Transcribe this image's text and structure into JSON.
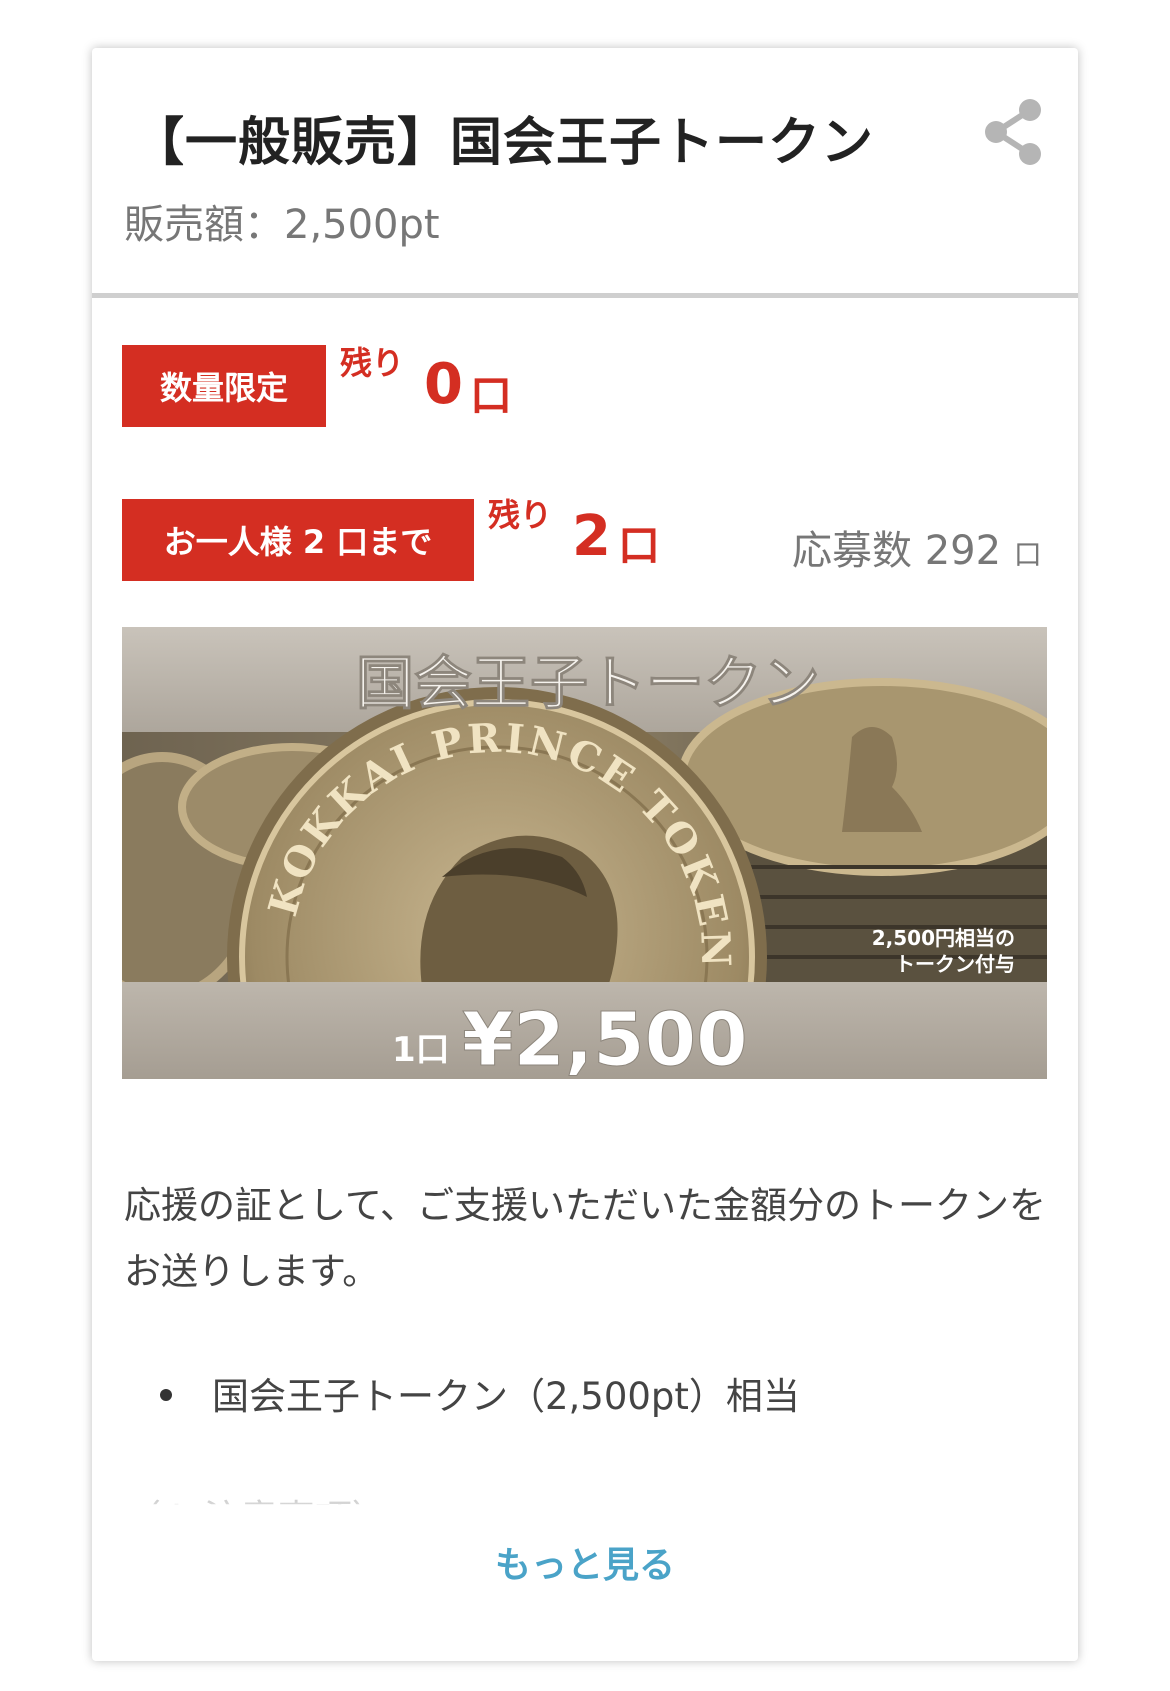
{
  "card": {
    "title": "【一般販売】国会王子トークン",
    "price": "販売額：2,500pt",
    "share_icon": "share-icon"
  },
  "limits": {
    "quantity": {
      "badge": "数量限定",
      "remain_label": "残り",
      "remain_value": "0",
      "unit": "口"
    },
    "per_person": {
      "badge": "お一人様 2 口まで",
      "remain_label": "残り",
      "remain_value": "2",
      "unit": "口"
    },
    "applicants": {
      "label": "応募数",
      "value": "292",
      "unit": "口"
    }
  },
  "banner": {
    "title": "国会王子トークン",
    "coin_text": "KOKKAI PRINCE TOKEN",
    "note_line1": "2,500円相当の",
    "note_line2": "トークン付与",
    "unit_label": "1口",
    "price": "¥2,500"
  },
  "description": {
    "text": "応援の証として、ご支援いただいた金額分のトークンをお送りします。",
    "bullets": [
      "国会王子トークン（2,500pt）相当"
    ],
    "cut_text": "（※ 注意事項）"
  },
  "more_label": "もっと見る"
}
